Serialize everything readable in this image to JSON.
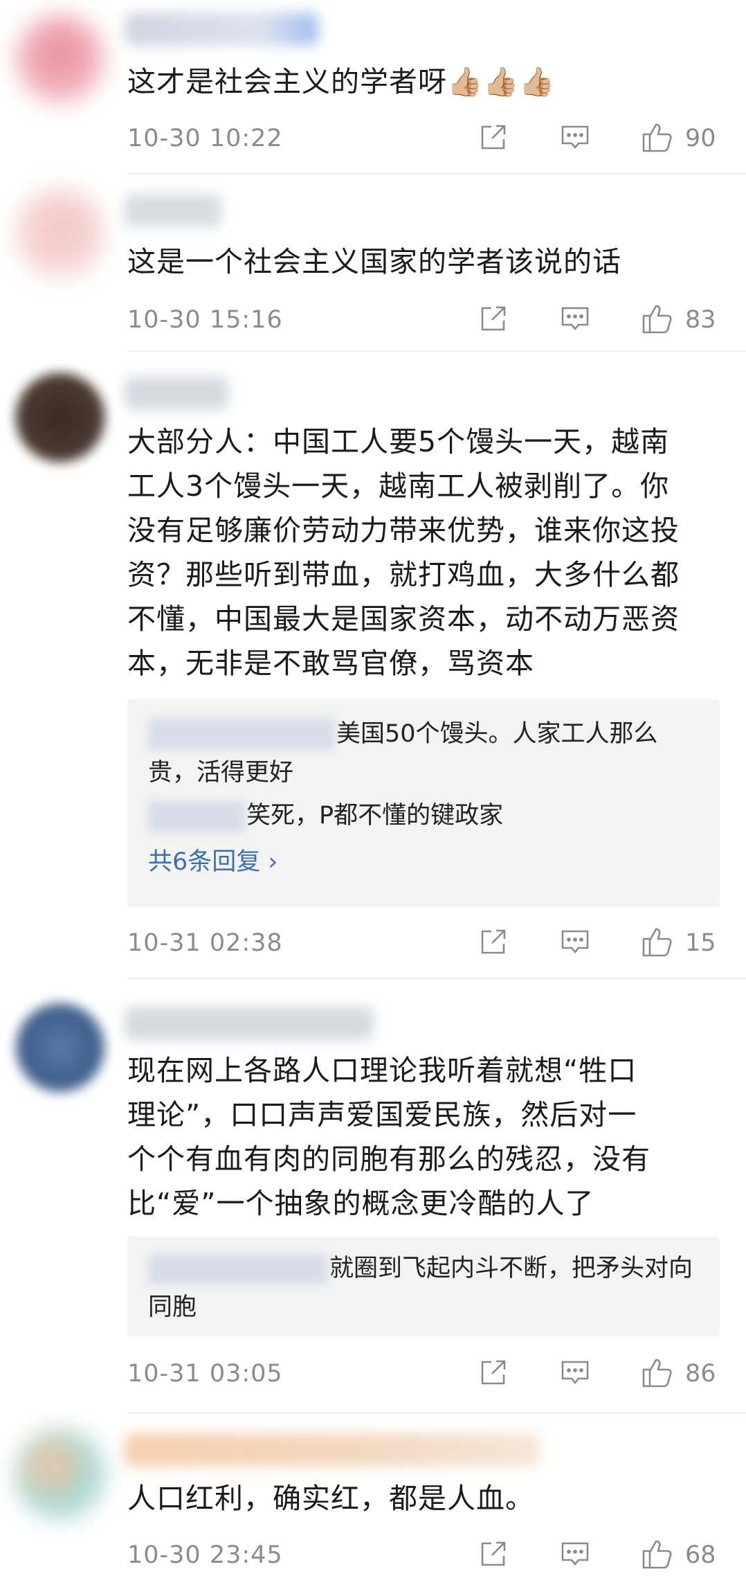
{
  "comments": [
    {
      "text": "这才是社会主义的学者呀👍🏼👍🏼👍🏼",
      "time": "10-30 10:22",
      "likes": "90"
    },
    {
      "text": "这是一个社会主义国家的学者该说的话",
      "time": "10-30 15:16",
      "likes": "83"
    },
    {
      "text": "大部分人：中国工人要5个馒头一天，越南\n工人3个馒头一天，越南工人被剥削了。你\n没有足够廉价劳动力带来优势，谁来你这投\n资？那些听到带血，就打鸡血，大多什么都\n不懂，中国最大是国家资本，动不动万恶资\n本，无非是不敢骂官僚，骂资本",
      "replies": [
        {
          "text": "美国50个馒头。人家工人那么贵，活得更好"
        },
        {
          "text": "笑死，P都不懂的键政家"
        }
      ],
      "more_replies": "共6条回复 ›",
      "time": "10-31 02:38",
      "likes": "15"
    },
    {
      "text": "现在网上各路人口理论我听着就想“牲口\n理论”，口口声声爱国爱民族，然后对一\n个个有血有肉的同胞有那么的残忍，没有\n比“爱”一个抽象的概念更冷酷的人了",
      "replies": [
        {
          "text": "就圈到飞起内斗不断，把矛头对向同胞"
        }
      ],
      "time": "10-31 03:05",
      "likes": "86"
    },
    {
      "text": "人口红利，确实红，都是人血。",
      "time": "10-30 23:45",
      "likes": "68"
    }
  ],
  "icons": {
    "share": "share-icon",
    "reply": "comment-icon",
    "like": "thumbs-up-icon"
  },
  "colors": {
    "link": "#3a6fb0",
    "meta": "#8b8b8b",
    "reply_bg": "#f3f3f3"
  }
}
